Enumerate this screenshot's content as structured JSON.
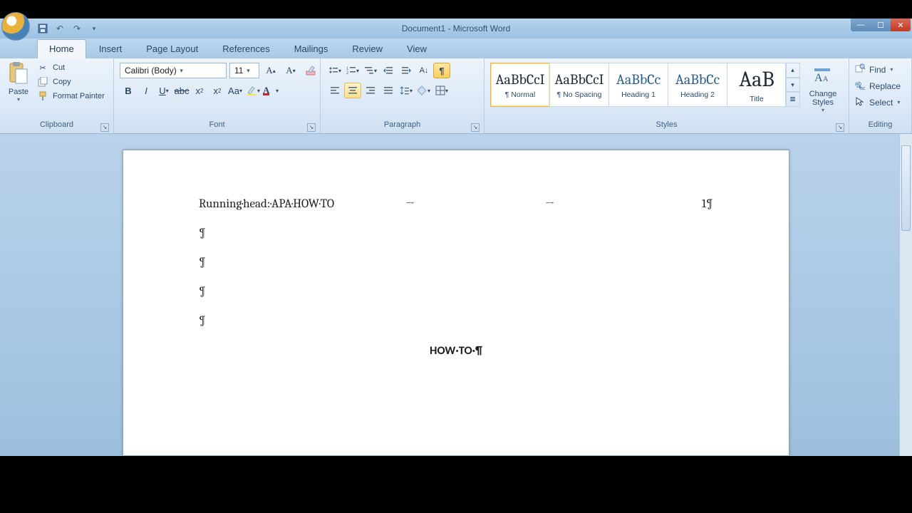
{
  "title": "Document1 - Microsoft Word",
  "qat": {
    "save": "💾",
    "undo": "↶",
    "redo": "↷"
  },
  "tabs": [
    "Home",
    "Insert",
    "Page Layout",
    "References",
    "Mailings",
    "Review",
    "View"
  ],
  "active_tab": "Home",
  "clipboard": {
    "paste": "Paste",
    "cut": "Cut",
    "copy": "Copy",
    "format_painter": "Format Painter",
    "label": "Clipboard"
  },
  "font": {
    "family": "Calibri (Body)",
    "size": "11",
    "label": "Font"
  },
  "paragraph": {
    "label": "Paragraph"
  },
  "styles": {
    "label": "Styles",
    "change": "Change Styles",
    "items": [
      {
        "sample": "AaBbCcI",
        "name": "¶ Normal"
      },
      {
        "sample": "AaBbCcI",
        "name": "¶ No Spacing"
      },
      {
        "sample": "AaBbCc",
        "name": "Heading 1"
      },
      {
        "sample": "AaBbCc",
        "name": "Heading 2"
      },
      {
        "sample": "AaB",
        "name": "Title"
      }
    ]
  },
  "editing": {
    "find": "Find",
    "replace": "Replace",
    "select": "Select",
    "label": "Editing"
  },
  "document": {
    "running_head": "Running·head:·APA·HOW·TO",
    "page_number": "1¶",
    "paragraph_mark": "¶",
    "title_line": "HOW·TO·¶"
  }
}
